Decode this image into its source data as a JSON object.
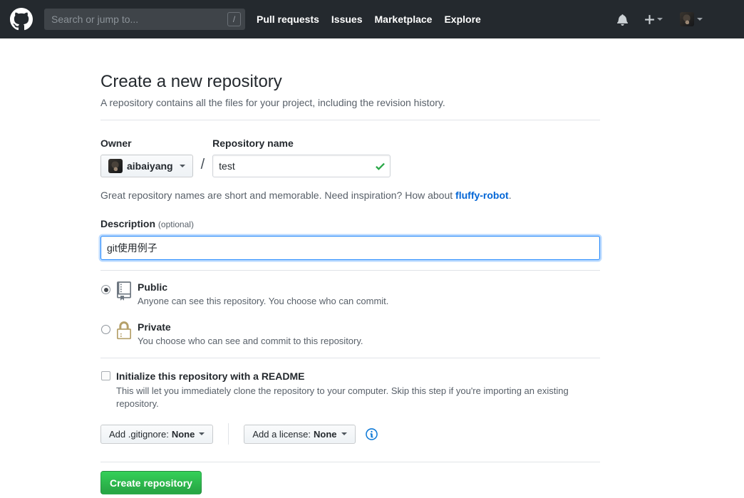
{
  "colors": {
    "header_bg": "#24292e",
    "link_blue": "#0366d6",
    "success_green": "#28a745",
    "focus_blue": "#2188ff",
    "lock_gold": "#b5a069",
    "repo_icon_gray": "#6e7781",
    "button_green_top": "#34d058",
    "button_green_bottom": "#28a745"
  },
  "header": {
    "search": {
      "placeholder": "Search or jump to...",
      "shortcut_key": "/"
    },
    "nav": [
      {
        "label": "Pull requests"
      },
      {
        "label": "Issues"
      },
      {
        "label": "Marketplace"
      },
      {
        "label": "Explore"
      }
    ]
  },
  "page": {
    "title": "Create a new repository",
    "subtitle": "A repository contains all the files for your project, including the revision history."
  },
  "form": {
    "owner": {
      "label": "Owner",
      "value": "aibaiyang"
    },
    "separator": "/",
    "repo_name": {
      "label": "Repository name",
      "value": "test",
      "valid": true
    },
    "hint": {
      "before": "Great repository names are short and memorable. Need inspiration? How about ",
      "link": "fluffy-robot",
      "after": "."
    },
    "description": {
      "label": "Description",
      "optional": "(optional)",
      "value": "git使用例子",
      "focused": true
    },
    "visibility": [
      {
        "label": "Public",
        "description": "Anyone can see this repository. You choose who can commit.",
        "selected": true
      },
      {
        "label": "Private",
        "description": "You choose who can see and commit to this repository.",
        "selected": false
      }
    ],
    "readme": {
      "label": "Initialize this repository with a README",
      "note": "This will let you immediately clone the repository to your computer. Skip this step if you're importing an existing repository.",
      "checked": false
    },
    "gitignore": {
      "label": "Add .gitignore:",
      "value": "None"
    },
    "license": {
      "label": "Add a license:",
      "value": "None"
    },
    "submit_label": "Create repository"
  }
}
